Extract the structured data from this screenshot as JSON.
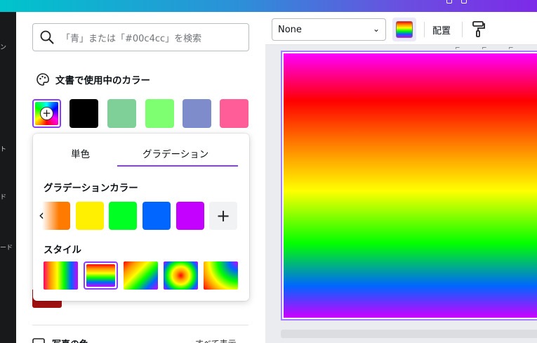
{
  "search": {
    "placeholder": "「青」または「#00c4cc」を検索"
  },
  "document_colors": {
    "title": "文書で使用中のカラー",
    "swatches": [
      "#000000",
      "#7fcf98",
      "#7eff72",
      "#7f8ccc",
      "#fe5d97"
    ]
  },
  "gradient_popup": {
    "tabs": [
      "単色",
      "グラデーション"
    ],
    "active_tab": "グラデーション",
    "gradient_colors_label": "グラデーションカラー",
    "gradient_colors": [
      "#ff7a00",
      "#ffef00",
      "#00ff22",
      "#0066ff",
      "#c400ff"
    ],
    "style_label": "スタイル",
    "styles": [
      "horizontal",
      "vertical",
      "diagonal",
      "radial",
      "corner-radial"
    ],
    "selected_style": "vertical"
  },
  "rail": {
    "fragments": [
      "ン",
      "ト",
      "ド",
      "ード"
    ]
  },
  "photo_colors": {
    "title": "写真の色",
    "link": "すべて表示"
  },
  "toolbar": {
    "select_value": "None",
    "arrange_label": "配置"
  },
  "colors": {
    "accent": "#8b3dff",
    "rail": "#18191b",
    "canvas_bg": "#ebecf0"
  }
}
